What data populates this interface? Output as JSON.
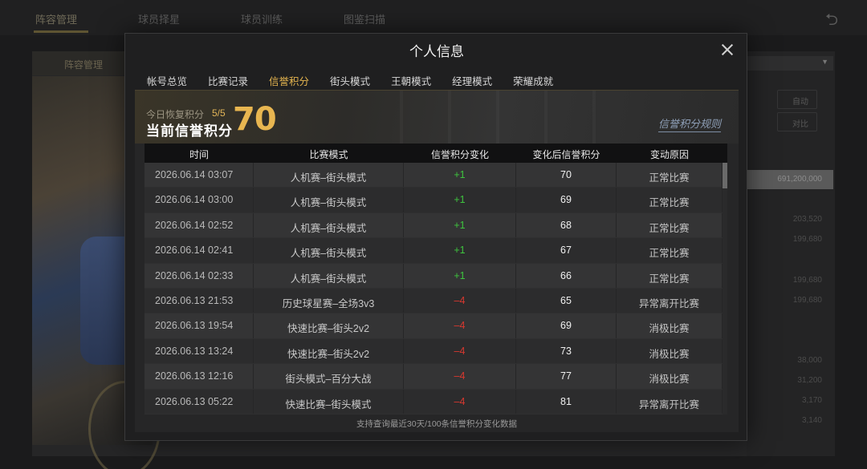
{
  "background": {
    "top_tabs": [
      "阵容管理",
      "球员择星",
      "球员训练",
      "图鉴扫描"
    ],
    "side_header": "阵容管理",
    "chips": [
      "自动",
      "对比"
    ],
    "highlight_value": "691,200,000",
    "right_numbers": [
      "203,520",
      "199,680",
      "199,680",
      "199,680",
      "38,000",
      "31,200",
      "3,170",
      "3,140"
    ]
  },
  "modal": {
    "title": "个人信息",
    "tabs": [
      "帐号总览",
      "比赛记录",
      "信誉积分",
      "街头模式",
      "王朝模式",
      "经理模式",
      "荣耀成就"
    ],
    "active_tab_index": 2
  },
  "banner": {
    "recover_label": "今日恢复积分",
    "recover_value": "5/5",
    "credit_label": "当前信誉积分",
    "credit_value": "70",
    "rules_link": "信誉积分规则"
  },
  "table": {
    "headers": [
      "时间",
      "比赛模式",
      "信誉积分变化",
      "变化后信誉积分",
      "变动原因"
    ],
    "rows": [
      {
        "time": "2026.06.14  03:07",
        "mode": "人机赛–街头模式",
        "change": "+1",
        "sign": "pos",
        "total": "70",
        "reason": "正常比赛"
      },
      {
        "time": "2026.06.14  03:00",
        "mode": "人机赛–街头模式",
        "change": "+1",
        "sign": "pos",
        "total": "69",
        "reason": "正常比赛"
      },
      {
        "time": "2026.06.14  02:52",
        "mode": "人机赛–街头模式",
        "change": "+1",
        "sign": "pos",
        "total": "68",
        "reason": "正常比赛"
      },
      {
        "time": "2026.06.14  02:41",
        "mode": "人机赛–街头模式",
        "change": "+1",
        "sign": "pos",
        "total": "67",
        "reason": "正常比赛"
      },
      {
        "time": "2026.06.14  02:33",
        "mode": "人机赛–街头模式",
        "change": "+1",
        "sign": "pos",
        "total": "66",
        "reason": "正常比赛"
      },
      {
        "time": "2026.06.13  21:53",
        "mode": "历史球星赛–全场3v3",
        "change": "–4",
        "sign": "neg",
        "total": "65",
        "reason": "异常离开比赛"
      },
      {
        "time": "2026.06.13  19:54",
        "mode": "快速比赛–街头2v2",
        "change": "–4",
        "sign": "neg",
        "total": "69",
        "reason": "消极比赛"
      },
      {
        "time": "2026.06.13  13:24",
        "mode": "快速比赛–街头2v2",
        "change": "–4",
        "sign": "neg",
        "total": "73",
        "reason": "消极比赛"
      },
      {
        "time": "2026.06.13  12:16",
        "mode": "街头模式–百分大战",
        "change": "–4",
        "sign": "neg",
        "total": "77",
        "reason": "消极比赛"
      },
      {
        "time": "2026.06.13  05:22",
        "mode": "快速比赛–街头模式",
        "change": "–4",
        "sign": "neg",
        "total": "81",
        "reason": "异常离开比赛"
      }
    ]
  },
  "footer_note": "支持查询最近30天/100条信誉积分变化数据",
  "colors": {
    "accent": "#e8b650",
    "positive": "#3ec43e",
    "negative": "#d9382f"
  }
}
